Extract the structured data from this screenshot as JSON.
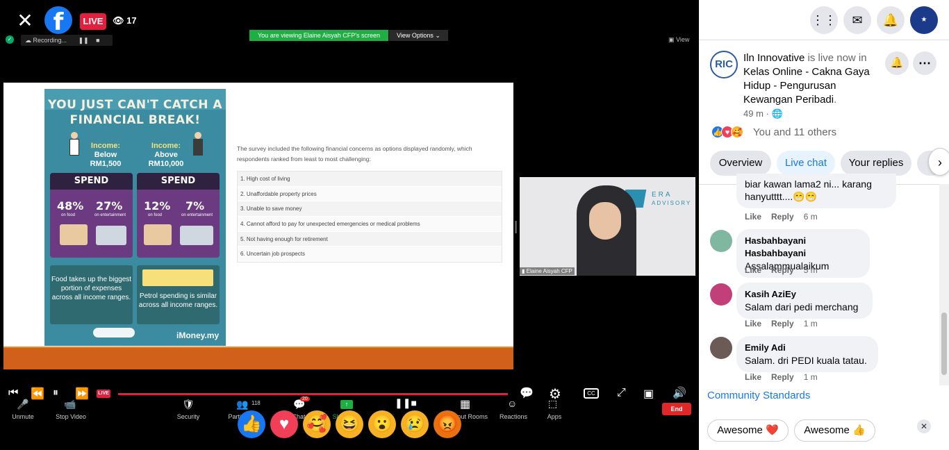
{
  "stream": {
    "live_label": "LIVE",
    "viewers": "17",
    "recording": "Recording...",
    "viewing_banner": "You are viewing Elaine Aisyah CFP's screen",
    "view_options": "View Options",
    "view_label": "View",
    "presenter": "Elaine Aisyah CFP",
    "era_brand": "ERA",
    "era_sub": "ADVISORY"
  },
  "slide": {
    "infographic_title": "YOU JUST CAN'T CATCH A FINANCIAL BREAK!",
    "left_income": "Income:",
    "left_income_val": "Below RM1,500",
    "right_income": "Income:",
    "right_income_val": "Above RM10,000",
    "spend": "SPEND",
    "left_pct_food": "48%",
    "left_pct_ent": "27%",
    "right_pct_food": "12%",
    "right_pct_ent": "7%",
    "on_food": "on food",
    "on_entertainment": "on entertainment",
    "food_box_text": "Food takes up the biggest portion of expenses across all income ranges.",
    "petrol_box_text": "Petrol spending is similar across all income ranges.",
    "brand": "iMoney.my",
    "survey_text": "The survey included the following financial concerns as options displayed randomly, which respondents ranked from least to most challenging:",
    "concerns": [
      "1. High cost of living",
      "2. Unaffordable property prices",
      "3. Unable to save money",
      "4. Cannot afford to pay for unexpected emergencies or medical problems",
      "5. Not having enough for retirement",
      "6. Uncertain job prospects"
    ]
  },
  "zoom_toolbar": {
    "unmute": "Unmute",
    "stop_video": "Stop Video",
    "security": "Security",
    "participants": "Partic",
    "participants_count": "118",
    "chat": "Chat",
    "chat_badge": "20",
    "share": "Sh",
    "rooms": "kout Rooms",
    "reactions": "Reactions",
    "apps": "Apps",
    "end": "End",
    "live_small": "LIVE"
  },
  "right_panel": {
    "channel_initials": "RIC",
    "channel_name": "Iln Innovative",
    "live_text": " is live now in ",
    "group_name": "Kelas Online - Cakna Gaya Hidup - Pengurusan Kewangan Peribadi",
    "period": ".",
    "time_ago": "49 m · ",
    "reactions_text": "You and 11 others",
    "tabs": [
      "Overview",
      "Live chat",
      "Your replies"
    ],
    "comments": [
      {
        "name": "",
        "text": "biar kawan lama2 ni... karang hanyutttt....😁😁",
        "time": "6 m"
      },
      {
        "name": "Hasbahbayani Hasbahbayani",
        "text": "Assalammualaikum",
        "time": "5 m"
      },
      {
        "name": "Kasih AziEy",
        "text": "Salam dari pedi merchang",
        "time": "1 m"
      },
      {
        "name": "Emily Adi",
        "text": "Salam. dri PEDI kuala tatau.",
        "time": "1 m"
      }
    ],
    "like": "Like",
    "reply": "Reply",
    "community_standards": "Community Standards",
    "quick_replies": [
      "Awesome ❤️",
      "Awesome 👍"
    ]
  }
}
